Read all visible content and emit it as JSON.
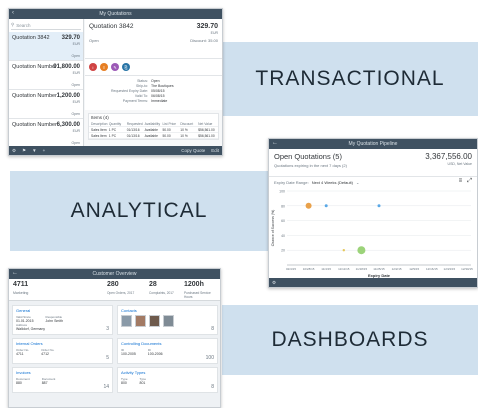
{
  "bands": {
    "transactional": "TRANSACTIONAL",
    "analytical": "ANALYTICAL",
    "dashboards": "DASHBOARDS"
  },
  "colors": {
    "band": "#cfe0ee",
    "shell": "#3f5161",
    "accent": "#0a6ed1"
  },
  "transactional": {
    "title": "My Quotations",
    "detail_title": "Quotation",
    "search_placeholder": "Search",
    "list": [
      {
        "title": "Quotation 3842",
        "amount": "329.70",
        "currency": "EUR",
        "status": "Open"
      },
      {
        "title": "Quotation Number",
        "amount": "91,800.00",
        "currency": "EUR",
        "status": "Open"
      },
      {
        "title": "Quotation Number",
        "amount": "1,200.00",
        "currency": "EUR",
        "status": "Open"
      },
      {
        "title": "Quotation Number",
        "amount": "6,300.00",
        "currency": "EUR",
        "status": "Open"
      }
    ],
    "detail": {
      "title": "Quotation 3842",
      "amount": "329.70",
      "currency": "EUR",
      "discount": "Discount: 35.00",
      "status": "Open"
    },
    "form_rows": [
      {
        "key": "Status:",
        "value": "Open"
      },
      {
        "key": "Ship-to:",
        "value": "The Boutiques"
      },
      {
        "key": "Requested Expiry Date:",
        "value": "05/08/15"
      },
      {
        "key": "Valid To:",
        "value": "06/08/15"
      },
      {
        "key": "Payment Terms:",
        "value": "Immediate"
      }
    ],
    "table": {
      "title": "Items (4)",
      "headers": [
        "Description",
        "Quantity",
        "Requested",
        "Availability",
        "List Price",
        "Discount",
        "Net Value"
      ],
      "rows": [
        [
          "Sales Item",
          "1 PC",
          "01/13/16",
          "Available",
          "50.00",
          "10 %",
          "$56,561.00"
        ],
        [
          "Sales Item",
          "1 PC",
          "01/13/16",
          "Available",
          "50.00",
          "10 %",
          "$56,561.00"
        ]
      ]
    },
    "footer": [
      "Copy Quote",
      "Edit"
    ]
  },
  "analytical": {
    "title": "My Quotation Pipeline",
    "header_title": "Open Quotations (5)",
    "header_sub": "Quotations expiring in the next 7 days (2)",
    "header_value": "3,367,556.00",
    "header_currency": "USD, Net Value",
    "filter_label": "Expiry Date Range:",
    "filter_value": "Next 4 Weeks (Default)",
    "chart_data": {
      "type": "scatter",
      "xlabel": "Expiry Date",
      "ylabel": "Chance of Success (%)",
      "ylim": [
        0,
        100
      ],
      "x_ticks": [
        "02/4/15",
        "10/28/15",
        "11/4/15",
        "11/11/15",
        "11/18/15",
        "11/25/15",
        "12/2/15",
        "12/9/15",
        "12/16/15",
        "12/23/15",
        "12/30/15"
      ],
      "y_ticks": [
        "20",
        "40",
        "60",
        "80",
        "100"
      ],
      "points": [
        {
          "x": "10/28/15",
          "y": 80,
          "size": 3,
          "color": "#e9a14a"
        },
        {
          "x": "11/4/15",
          "y": 80,
          "size": 1.5,
          "color": "#5aa8e6"
        },
        {
          "x": "11/25/15",
          "y": 80,
          "size": 1.5,
          "color": "#5aa8e6"
        },
        {
          "x": "11/11/15",
          "y": 20,
          "size": 1.2,
          "color": "#e5c85c"
        },
        {
          "x": "11/18/15",
          "y": 20,
          "size": 4,
          "color": "#9cd37a"
        }
      ]
    }
  },
  "dashboards": {
    "title": "Customer Overview",
    "kpi_main": {
      "value": "4711",
      "label": "Marketing"
    },
    "kpis": [
      {
        "value": "280",
        "label": "Open Orders, 2017"
      },
      {
        "value": "28",
        "label": "Complaints, 2017"
      },
      {
        "value": "1200h",
        "label": "Purchased Service Hours"
      }
    ],
    "cards": {
      "general": {
        "title": "General",
        "fields": [
          {
            "l": "Valid Since",
            "v": "01.01.2015"
          },
          {
            "l": "Responsible",
            "v": "John Smith"
          },
          {
            "l": "Address",
            "v": "Walldorf, Germany"
          }
        ],
        "count": "3"
      },
      "contacts": {
        "title": "Contacts",
        "count": "8"
      },
      "internal_orders": {
        "title": "Internal Orders",
        "fields": [
          {
            "l": "Order No.",
            "v": "4711"
          },
          {
            "l": "Order No.",
            "v": "4712"
          }
        ],
        "count": "5"
      },
      "controlling": {
        "title": "Controlling Documents",
        "fields": [
          {
            "l": "ID",
            "v": "100-2005"
          },
          {
            "l": "ID",
            "v": "100-2006"
          }
        ],
        "count": "100"
      },
      "invoices": {
        "title": "Invoices",
        "fields": [
          {
            "l": "Document",
            "v": "880"
          },
          {
            "l": "Document",
            "v": "887"
          }
        ],
        "count": "14"
      },
      "activity": {
        "title": "Activity Types",
        "fields": [
          {
            "l": "Type",
            "v": "800"
          },
          {
            "l": "Type",
            "v": "801"
          }
        ],
        "count": "8"
      }
    }
  }
}
